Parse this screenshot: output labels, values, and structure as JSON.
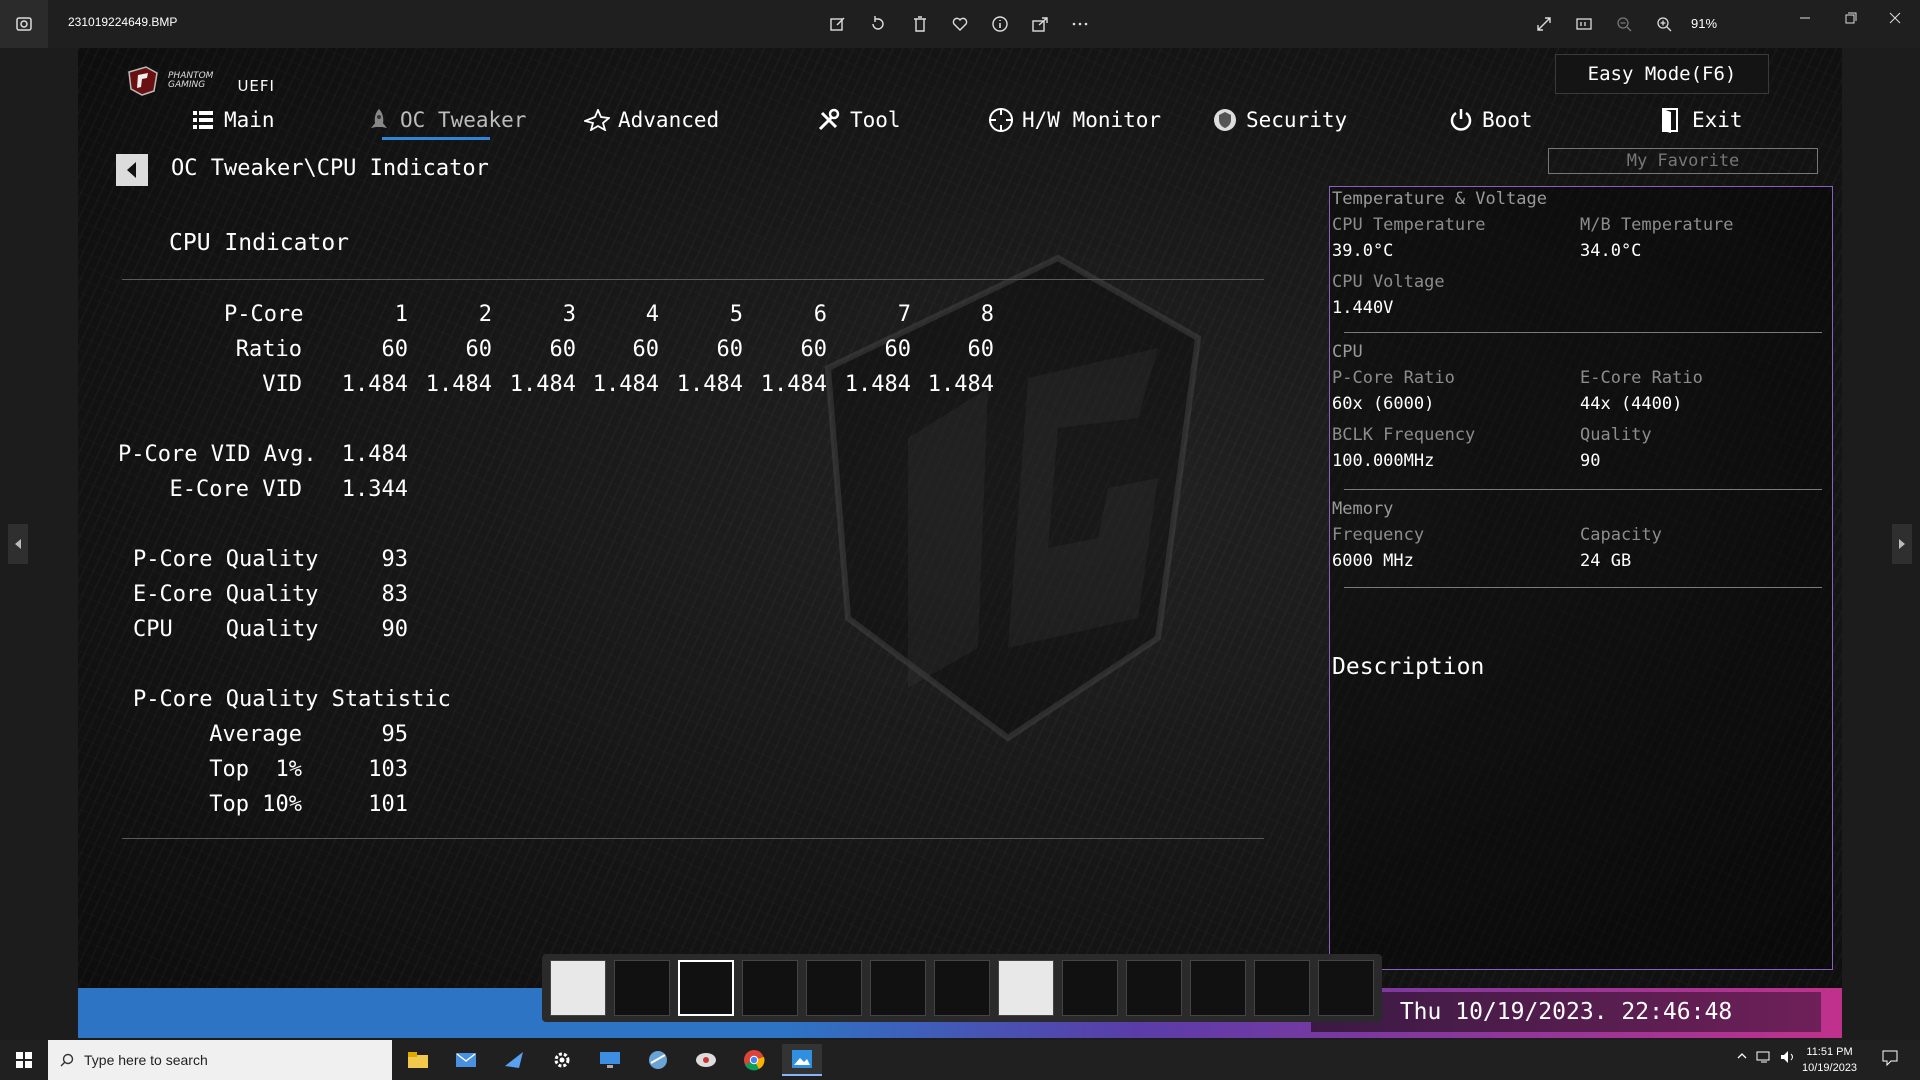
{
  "window": {
    "filename": "231019224649.BMP",
    "zoom": "91%"
  },
  "uefi": {
    "brand_line1": "PHANTOM",
    "brand_line2": "GAMING",
    "brand_uefi": "UEFI",
    "easy_mode": "Easy Mode(F6)",
    "nav": [
      "Main",
      "OC Tweaker",
      "Advanced",
      "Tool",
      "H/W Monitor",
      "Security",
      "Boot",
      "Exit"
    ],
    "my_favorite": "My Favorite",
    "breadcrumb": "OC Tweaker\\CPU Indicator",
    "section_title": "CPU Indicator",
    "grid": {
      "row_pcore": "P-Core",
      "row_ratio": "Ratio",
      "row_vid": "VID",
      "cores": [
        "1",
        "2",
        "3",
        "4",
        "5",
        "6",
        "7",
        "8"
      ],
      "ratios": [
        "60",
        "60",
        "60",
        "60",
        "60",
        "60",
        "60",
        "60"
      ],
      "vids": [
        "1.484",
        "1.484",
        "1.484",
        "1.484",
        "1.484",
        "1.484",
        "1.484",
        "1.484"
      ]
    },
    "vid_summary": {
      "pcore_avg_label": "P-Core VID Avg.",
      "pcore_avg_value": "1.484",
      "ecore_label": "E-Core VID",
      "ecore_value": "1.344"
    },
    "quality": {
      "pcore_label": "P-Core Quality",
      "pcore_value": "93",
      "ecore_label": "E-Core Quality",
      "ecore_value": "83",
      "cpu_label": "CPU    Quality",
      "cpu_value": "90"
    },
    "statistic": {
      "title": "P-Core Quality Statistic",
      "average_label": "Average",
      "average_value": "95",
      "top1_label": "Top  1%",
      "top1_value": "103",
      "top10_label": "Top 10%",
      "top10_value": "101"
    },
    "panel": {
      "temp_header": "Temperature & Voltage",
      "cpu_temp_label": "CPU Temperature",
      "cpu_temp_value": "39.0°C",
      "mb_temp_label": "M/B Temperature",
      "mb_temp_value": "34.0°C",
      "cpu_volt_label": "CPU Voltage",
      "cpu_volt_value": "1.440V",
      "cpu_header": "CPU",
      "pcore_ratio_label": "P-Core Ratio",
      "pcore_ratio_value": "60x (6000)",
      "ecore_ratio_label": "E-Core Ratio",
      "ecore_ratio_value": "44x (4400)",
      "bclk_label": "BCLK Frequency",
      "bclk_value": "100.000MHz",
      "quality_label": "Quality",
      "quality_value": "90",
      "mem_header": "Memory",
      "freq_label": "Frequency",
      "freq_value": "6000 MHz",
      "cap_label": "Capacity",
      "cap_value": "24 GB",
      "description": "Description"
    },
    "datetime": "Thu 10/19/2023. 22:46:48"
  },
  "taskbar": {
    "search_placeholder": "Type here to search",
    "time": "11:51 PM",
    "date": "10/19/2023"
  }
}
